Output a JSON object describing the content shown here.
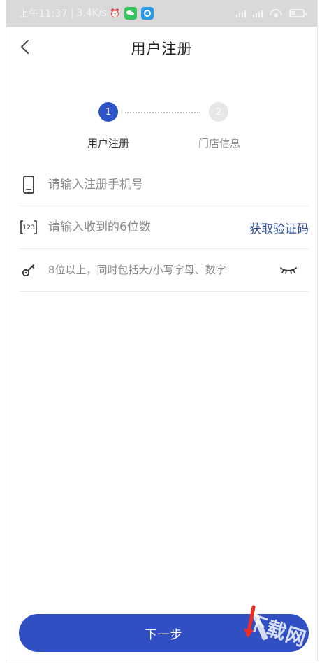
{
  "status_bar": {
    "time": "上午11:37",
    "network_speed": "3.4K/s",
    "battery_level": 0.35
  },
  "header": {
    "title": "用户注册"
  },
  "stepper": {
    "steps": [
      {
        "number": "1",
        "label": "用户注册",
        "active": true
      },
      {
        "number": "2",
        "label": "门店信息",
        "active": false
      }
    ]
  },
  "form": {
    "phone": {
      "placeholder": "请输入注册手机号",
      "value": ""
    },
    "code": {
      "placeholder": "请输入收到的6位数",
      "value": "",
      "action_label": "获取验证码"
    },
    "password": {
      "placeholder": "8位以上，同时包括大/小写字母、数字",
      "value": ""
    }
  },
  "footer": {
    "next_label": "下一步"
  },
  "watermark": {
    "text": "下载网"
  },
  "colors": {
    "primary": "#2f4fc2",
    "primary_dark": "#2e4b99",
    "step_inactive": "#e7e7e7",
    "status_bar_bg": "#d9d9d9"
  }
}
